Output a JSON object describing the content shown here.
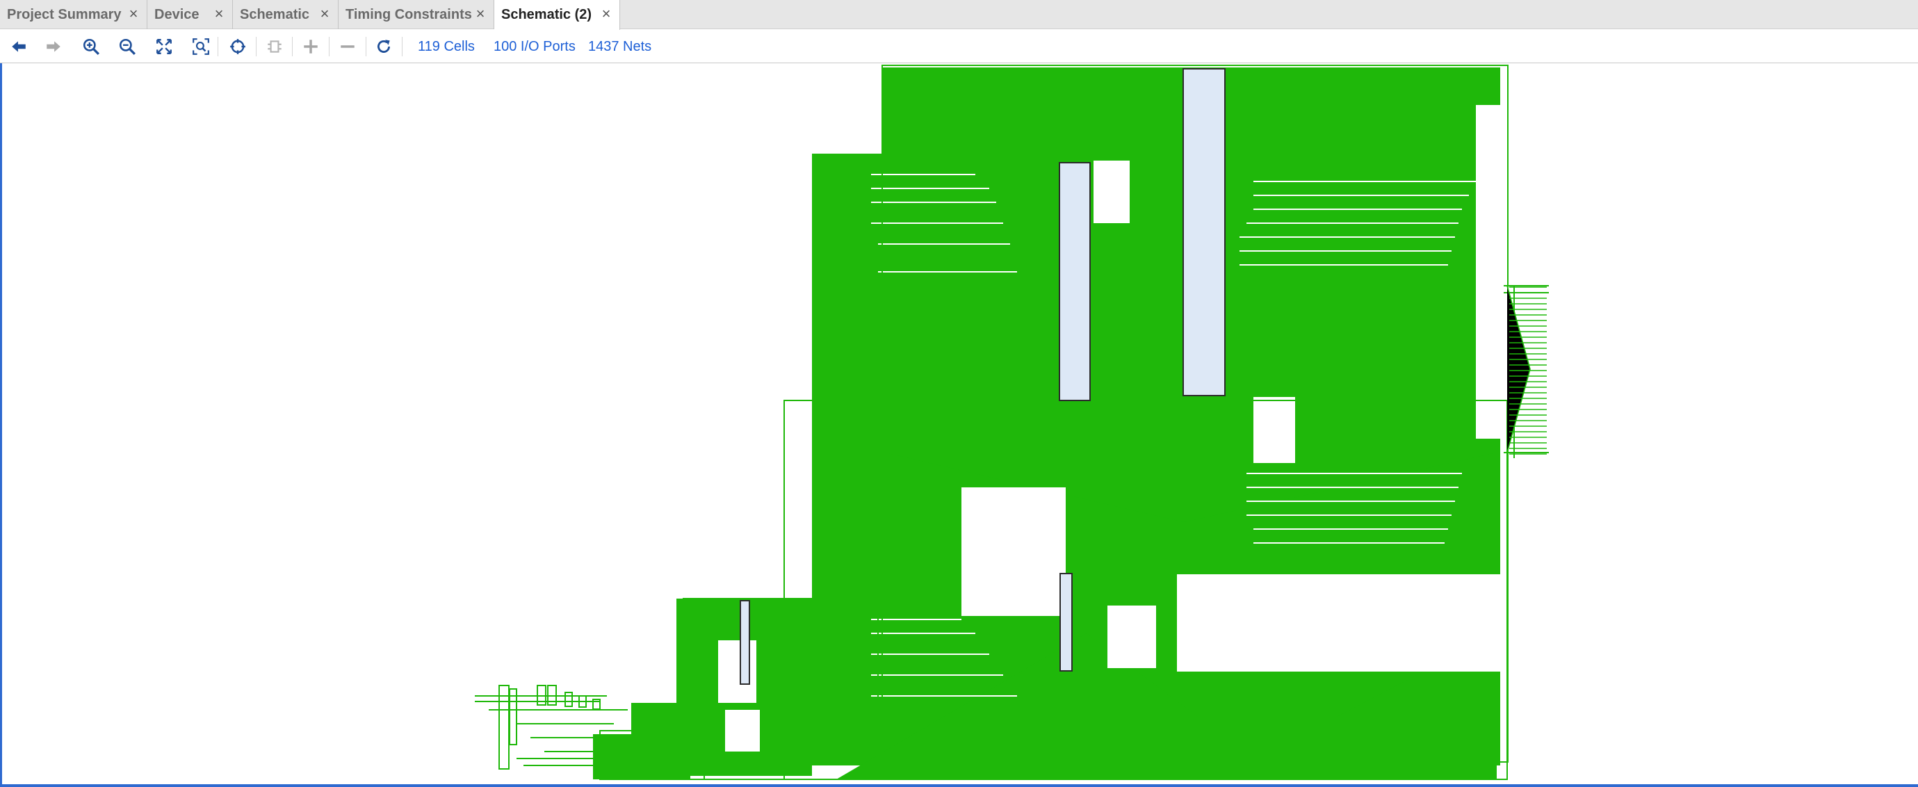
{
  "tabs": [
    {
      "label": "Project Summary",
      "active": false
    },
    {
      "label": "Device",
      "active": false
    },
    {
      "label": "Schematic",
      "active": false
    },
    {
      "label": "Timing Constraints",
      "active": false
    },
    {
      "label": "Schematic (2)",
      "active": true
    }
  ],
  "tab_close_glyph": "×",
  "toolbar": {
    "buttons": [
      "back-icon",
      "forward-icon",
      "zoom-in-icon",
      "zoom-out-icon",
      "zoom-fit-icon",
      "zoom-area-icon",
      "select-icon",
      "route-icon",
      "expand-icon",
      "collapse-icon",
      "refresh-icon"
    ],
    "cells": "119 Cells",
    "io_ports": "100 I/O Ports",
    "nets": "1437 Nets"
  },
  "colors": {
    "net": "#1fb80a",
    "cell_fill": "#dde8f6",
    "link": "#1d5fd6",
    "frame": "#2f6ad0"
  }
}
